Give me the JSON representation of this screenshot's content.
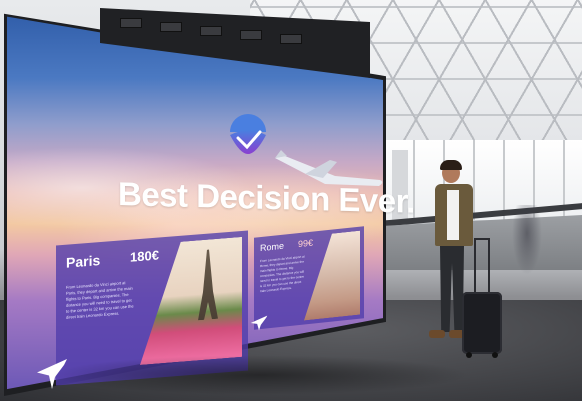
{
  "billboard": {
    "headline": "Best Decision Ever.",
    "cards": [
      {
        "city": "Paris",
        "price": "180€",
        "blurb": "From Leonardo da Vinci airport at Paris, they depart and arrive the main flights to Paris. Big companies. The distance you will need to travel to get to the center is 32 km you can use the direct train Leonardo Express."
      },
      {
        "city": "Rome",
        "price": "99€",
        "blurb": "From Leonardo da Vinci airport at Rome, they depart and arrive the main flights to Rome. Big companies. The distance you will need to travel to get to the center is 32 km you can use the direct train Leonardo Express."
      }
    ]
  },
  "colors": {
    "logo_blue": "#4a7fe0",
    "logo_purple": "#8a3fd0",
    "card_purple": "#503caa"
  },
  "icons": [
    "brand-logo-icon",
    "airplane-icon"
  ]
}
